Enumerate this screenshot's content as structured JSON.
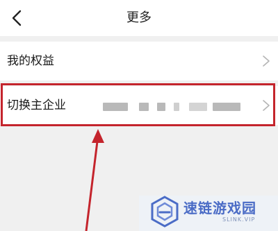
{
  "header": {
    "title": "更多"
  },
  "rows": [
    {
      "label": "我的权益"
    },
    {
      "label": "切换主企业"
    }
  ],
  "watermark": {
    "name": "速链游戏园",
    "subtitle": "SLINK.VIP"
  },
  "colors": {
    "highlight": "#c4242c",
    "watermark_accent": "#4b6cc6"
  },
  "icons": {
    "back": "chevron-left-icon",
    "row_arrow": "chevron-right-icon"
  }
}
